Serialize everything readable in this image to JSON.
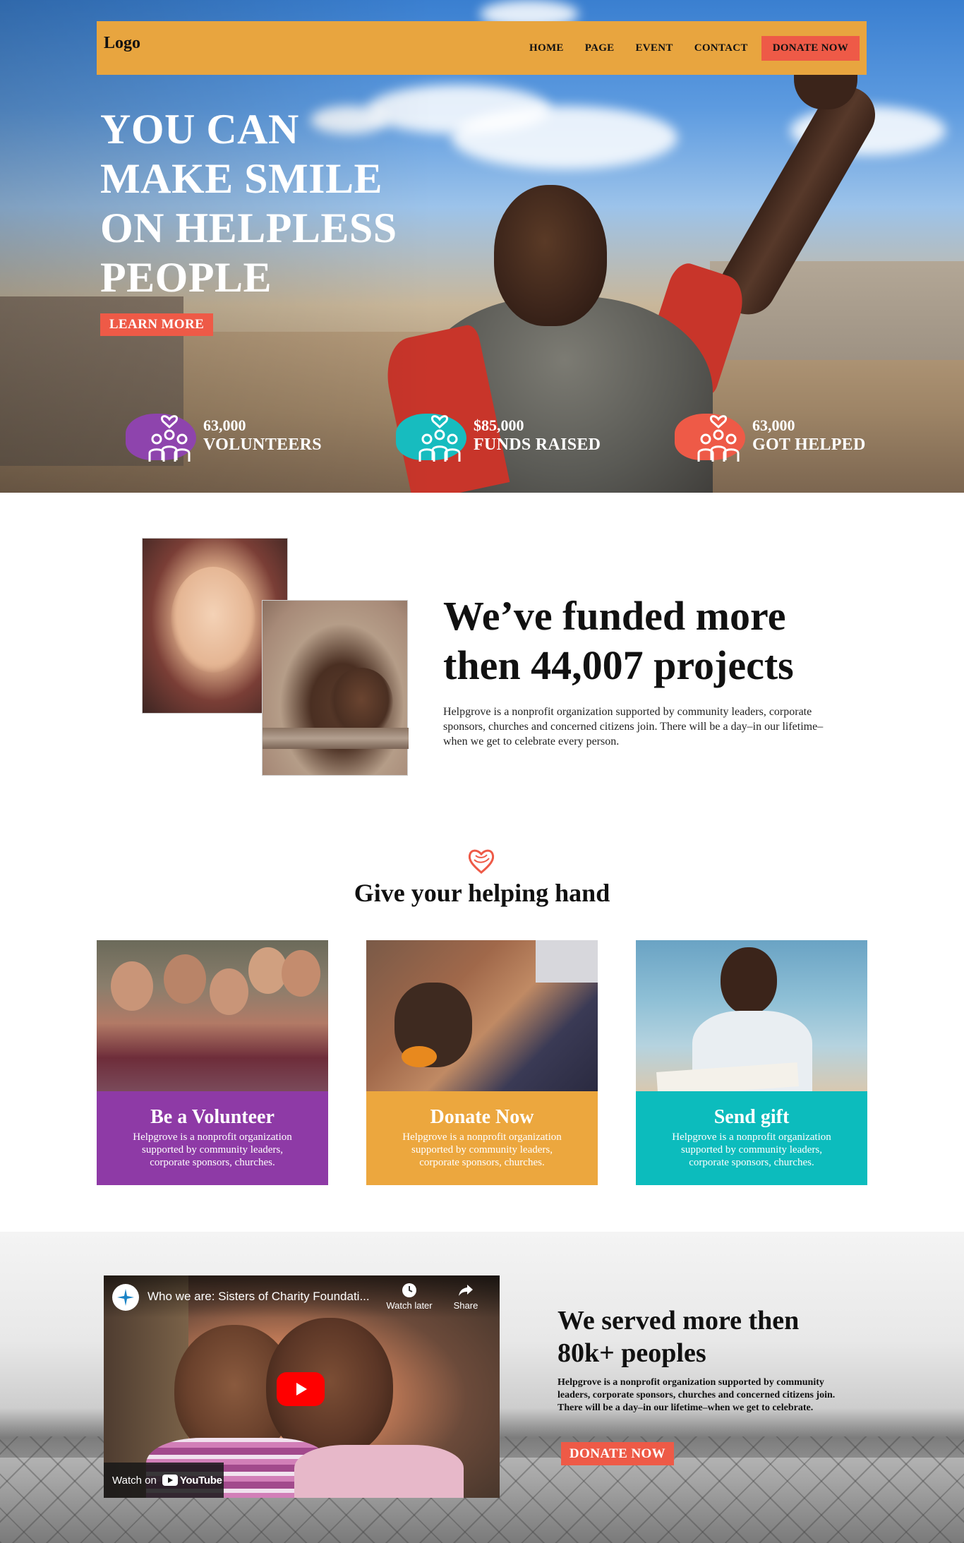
{
  "nav": {
    "logo": "Logo",
    "links": [
      "HOME",
      "PAGE",
      "EVENT",
      "CONTACT"
    ],
    "donate": "DONATE NOW"
  },
  "hero": {
    "title_lines": [
      "YOU CAN",
      "MAKE SMILE",
      "ON HELPLESS",
      "PEOPLE"
    ],
    "cta": "LEARN MORE",
    "stats": [
      {
        "value": "63,000",
        "label": "VOLUNTEERS",
        "color": "#8e44ad"
      },
      {
        "value": "$85,000",
        "label": "FUNDS RAISED",
        "color": "#17bcbf"
      },
      {
        "value": "63,000",
        "label": "GOT HELPED",
        "color": "#ee5a47"
      }
    ]
  },
  "funded": {
    "title_lines": [
      "We’ve funded more",
      "then 44,007 projects"
    ],
    "body": "Helpgrove is a nonprofit organization supported by community leaders, corporate sponsors, churches and concerned citizens join. There will be a day–in our lifetime–when we get to celebrate every person."
  },
  "help": {
    "title": "Give your helping hand",
    "cards": [
      {
        "title": "Be a Volunteer",
        "text": "Helpgrove is a nonprofit organization supported by community leaders, corporate sponsors, churches.",
        "color": "#8e3aa6"
      },
      {
        "title": "Donate Now",
        "text": "Helpgrove is a nonprofit organization supported by community leaders, corporate sponsors, churches.",
        "color": "#eca73e"
      },
      {
        "title": "Send gift",
        "text": "Helpgrove is a nonprofit organization supported by community leaders, corporate sponsors, churches.",
        "color": "#0cbcbd"
      }
    ]
  },
  "video": {
    "title": "Who we are: Sisters of Charity Foundati...",
    "watch_later": "Watch later",
    "share": "Share",
    "watch_on": "Watch on",
    "youtube": "YouTube"
  },
  "served": {
    "title_lines": [
      "We served more then",
      "80k+ peoples"
    ],
    "body": "Helpgrove is a nonprofit organization supported by community leaders, corporate sponsors, churches and concerned citizens join. There will be a day–in our lifetime–when we get to celebrate.",
    "cta": "DONATE NOW"
  },
  "colors": {
    "nav_bg": "#e8a53f",
    "accent": "#ee5a47",
    "purple": "#8e3aa6",
    "orange": "#eca73e",
    "teal": "#0cbcbd"
  }
}
